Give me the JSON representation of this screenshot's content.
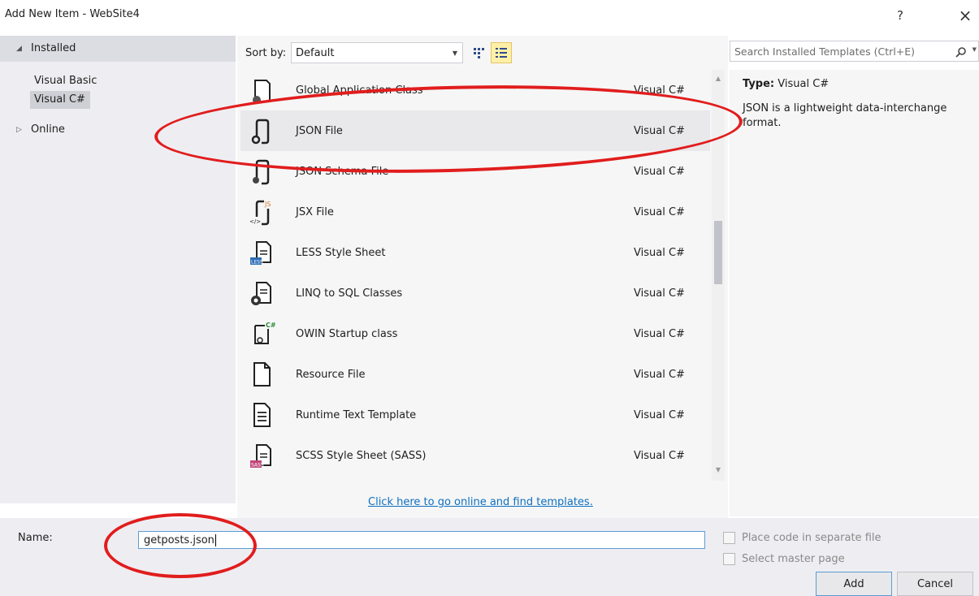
{
  "window": {
    "title": "Add New Item - WebSite4",
    "help_label": "?",
    "close_label": "×"
  },
  "tree": {
    "installed_label": "Installed",
    "children": [
      "Visual Basic",
      "Visual C#"
    ],
    "selected_child": "Visual C#",
    "online_label": "Online"
  },
  "toolbar": {
    "sort_label": "Sort by:",
    "sort_value": "Default"
  },
  "search": {
    "placeholder": "Search Installed Templates (Ctrl+E)"
  },
  "templates": [
    {
      "name": "Global Application Class",
      "lang": "Visual C#",
      "icon": "global-app-class-icon"
    },
    {
      "name": "JSON File",
      "lang": "Visual C#",
      "icon": "json-file-icon",
      "selected": true
    },
    {
      "name": "JSON Schema File",
      "lang": "Visual C#",
      "icon": "json-schema-file-icon"
    },
    {
      "name": "JSX File",
      "lang": "Visual C#",
      "icon": "jsx-file-icon"
    },
    {
      "name": "LESS Style Sheet",
      "lang": "Visual C#",
      "icon": "less-stylesheet-icon"
    },
    {
      "name": "LINQ to SQL Classes",
      "lang": "Visual C#",
      "icon": "linq-to-sql-icon"
    },
    {
      "name": "OWIN Startup class",
      "lang": "Visual C#",
      "icon": "owin-startup-icon"
    },
    {
      "name": "Resource File",
      "lang": "Visual C#",
      "icon": "resource-file-icon"
    },
    {
      "name": "Runtime Text Template",
      "lang": "Visual C#",
      "icon": "runtime-text-template-icon"
    },
    {
      "name": "SCSS Style Sheet (SASS)",
      "lang": "Visual C#",
      "icon": "scss-stylesheet-icon"
    }
  ],
  "details": {
    "type_label": "Type:",
    "type_value": "Visual C#",
    "description": "JSON is a lightweight data-interchange format."
  },
  "online_link": "Click here to go online and find templates.",
  "bottom": {
    "name_label": "Name:",
    "name_value": "getposts.json",
    "option1": "Place code in separate file",
    "option2": "Select master page",
    "add_label": "Add",
    "cancel_label": "Cancel"
  },
  "colors": {
    "annotation": "#e11d1d",
    "link": "#0e70c0",
    "focus_border": "#5b9bd5"
  }
}
